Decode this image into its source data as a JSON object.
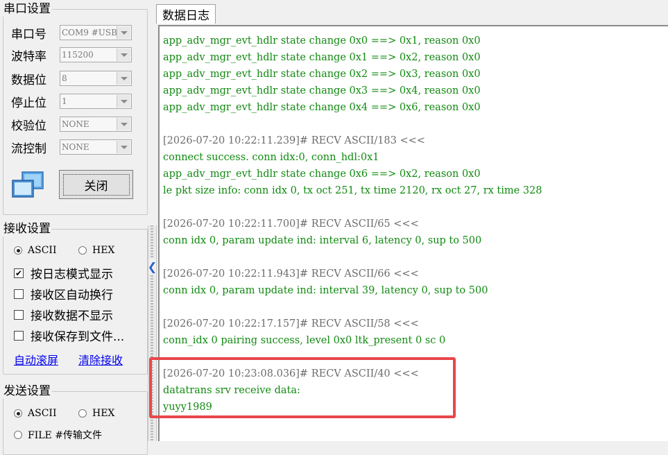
{
  "serial": {
    "title": "串口设置",
    "fields": [
      {
        "label": "串口号",
        "value": "COM9 #USB"
      },
      {
        "label": "波特率",
        "value": "115200"
      },
      {
        "label": "数据位",
        "value": "8"
      },
      {
        "label": "停止位",
        "value": "1"
      },
      {
        "label": "校验位",
        "value": "NONE"
      },
      {
        "label": "流控制",
        "value": "NONE"
      }
    ],
    "close_label": "关闭"
  },
  "receive": {
    "title": "接收设置",
    "ascii_label": "ASCII",
    "hex_label": "HEX",
    "selected": "ASCII",
    "options": [
      {
        "label": "按日志模式显示",
        "checked": true
      },
      {
        "label": "接收区自动换行",
        "checked": false
      },
      {
        "label": "接收数据不显示",
        "checked": false
      },
      {
        "label": "接收保存到文件...",
        "checked": false
      }
    ],
    "auto_scroll": "自动滚屏",
    "clear": "清除接收"
  },
  "send": {
    "title": "发送设置",
    "ascii_label": "ASCII",
    "hex_label": "HEX",
    "file_label": "FILE #传输文件"
  },
  "log": {
    "tab": "数据日志",
    "lines": [
      {
        "kind": "data",
        "text": "app_adv_mgr_evt_hdlr state change 0x0 ==> 0x1, reason 0x0"
      },
      {
        "kind": "data",
        "text": "app_adv_mgr_evt_hdlr state change 0x1 ==> 0x2, reason 0x0"
      },
      {
        "kind": "data",
        "text": "app_adv_mgr_evt_hdlr state change 0x2 ==> 0x3, reason 0x0"
      },
      {
        "kind": "data",
        "text": "app_adv_mgr_evt_hdlr state change 0x3 ==> 0x4, reason 0x0"
      },
      {
        "kind": "data",
        "text": "app_adv_mgr_evt_hdlr state change 0x4 ==> 0x6, reason 0x0"
      },
      {
        "kind": "blank",
        "text": ""
      },
      {
        "kind": "head",
        "text": "[2026-07-20 10:22:11.239]# RECV ASCII/183 <<<"
      },
      {
        "kind": "data",
        "text": "connect success. conn idx:0, conn_hdl:0x1"
      },
      {
        "kind": "data",
        "text": "app_adv_mgr_evt_hdlr state change 0x6 ==> 0x2, reason 0x0"
      },
      {
        "kind": "data",
        "text": "le pkt size info: conn idx 0, tx oct 251, tx time 2120, rx oct 27, rx time 328"
      },
      {
        "kind": "blank",
        "text": ""
      },
      {
        "kind": "head",
        "text": "[2026-07-20 10:22:11.700]# RECV ASCII/65 <<<"
      },
      {
        "kind": "data",
        "text": "conn idx 0, param update ind: interval 6, latency 0, sup to 500"
      },
      {
        "kind": "blank",
        "text": ""
      },
      {
        "kind": "head",
        "text": "[2026-07-20 10:22:11.943]# RECV ASCII/66 <<<"
      },
      {
        "kind": "data",
        "text": "conn idx 0, param update ind: interval 39, latency 0, sup to 500"
      },
      {
        "kind": "blank",
        "text": ""
      },
      {
        "kind": "head",
        "text": "[2026-07-20 10:22:17.157]# RECV ASCII/58 <<<"
      },
      {
        "kind": "data",
        "text": "conn_idx 0 pairing success, level 0x0 ltk_present 0 sc 0"
      },
      {
        "kind": "blank",
        "text": ""
      },
      {
        "kind": "head",
        "text": "[2026-07-20 10:23:08.036]# RECV ASCII/40 <<<"
      },
      {
        "kind": "data",
        "text": "datatrans srv receive data:"
      },
      {
        "kind": "data",
        "text": "yuyy1989"
      }
    ]
  },
  "colors": {
    "data_text": "#118a11",
    "header_text": "#6c6c6c",
    "highlight": "#e8474b"
  }
}
